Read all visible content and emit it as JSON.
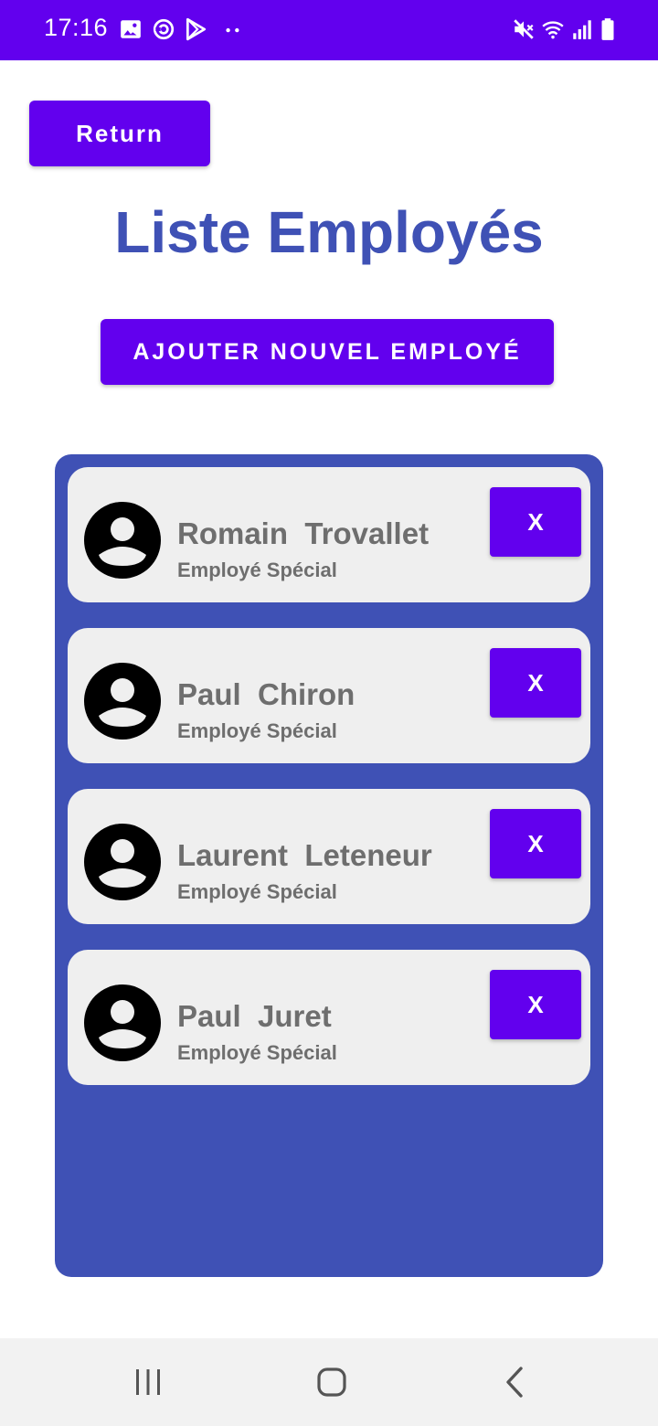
{
  "status_bar": {
    "time": "17:16",
    "left_icons": [
      "image-icon",
      "sync-icon",
      "play-store-icon",
      "more-dots-icon"
    ],
    "right_icons": [
      "mute-icon",
      "wifi-icon",
      "signal-icon",
      "battery-icon"
    ],
    "background_color": "#6200EE"
  },
  "toolbar": {
    "return_label": "Return"
  },
  "page": {
    "title": "Liste Employés",
    "add_button_label": "AJOUTER NOUVEL EMPLOYÉ"
  },
  "employees": [
    {
      "first_name": "Romain",
      "last_name": "Trovallet",
      "display_name": "Romain  Trovallet",
      "role": "Employé Spécial",
      "delete_label": "X"
    },
    {
      "first_name": "Paul",
      "last_name": "Chiron",
      "display_name": "Paul  Chiron",
      "role": "Employé Spécial",
      "delete_label": "X"
    },
    {
      "first_name": "Laurent",
      "last_name": "Leteneur",
      "display_name": "Laurent  Leteneur",
      "role": "Employé Spécial",
      "delete_label": "X"
    },
    {
      "first_name": "Paul",
      "last_name": "Juret",
      "display_name": "Paul  Juret",
      "role": "Employé Spécial",
      "delete_label": "X"
    }
  ],
  "nav_bar": {
    "buttons": [
      "recents-icon",
      "home-icon",
      "back-icon"
    ]
  },
  "colors": {
    "primary": "#6200EE",
    "accent_blue": "#3F51B5",
    "card_background": "#EFEFEF",
    "text_gray": "#6E6E6E"
  }
}
